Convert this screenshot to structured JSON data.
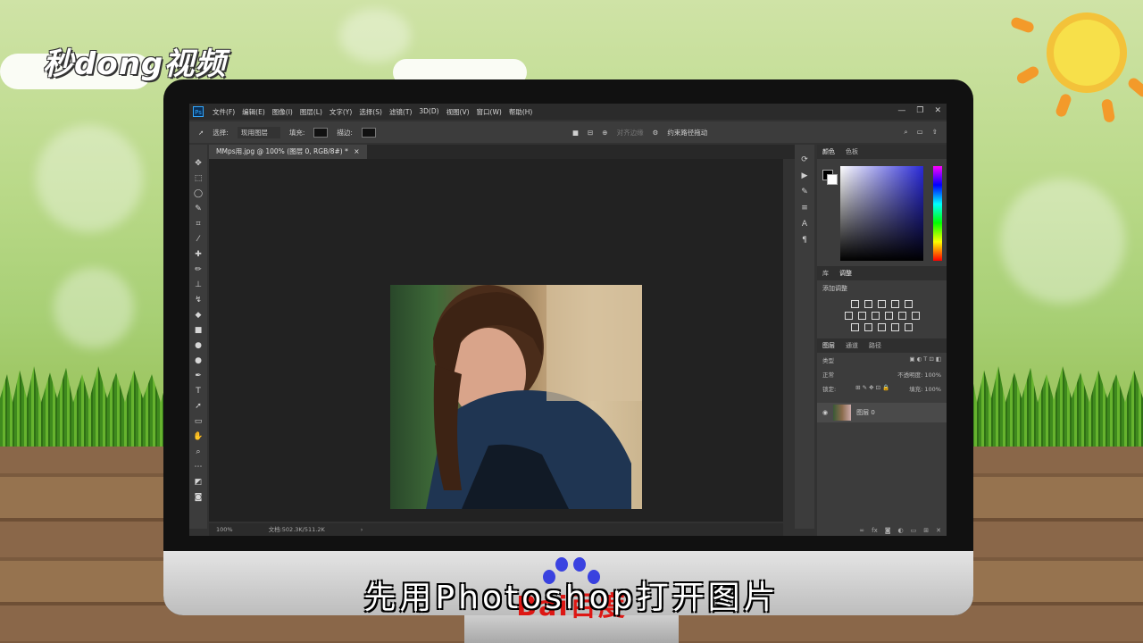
{
  "watermark": {
    "logo_text": "秒dong视频"
  },
  "window": {
    "menu": [
      "文件(F)",
      "编辑(E)",
      "图像(I)",
      "图层(L)",
      "文字(Y)",
      "选择(S)",
      "滤镜(T)",
      "3D(D)",
      "视图(V)",
      "窗口(W)",
      "帮助(H)"
    ],
    "controls": [
      "—",
      "❐",
      "✕"
    ]
  },
  "options_bar": {
    "select_label": "选择:",
    "select_value": "现用图层",
    "fill_label": "填充:",
    "stroke_label": "描边:",
    "align_edges": "对齐边缘",
    "constrain_path": "约束路径拖动"
  },
  "document_tab": {
    "label": "MMps用.jpg @ 100% (图层 0, RGB/8#) *",
    "close": "×"
  },
  "status_bar": {
    "zoom": "100%",
    "doc_info": "文档:502.3K/511.2K",
    "arrow": "›"
  },
  "panels": {
    "color_tabs": [
      "颜色",
      "色板"
    ],
    "adjust_tabs": [
      "库",
      "调整"
    ],
    "adjust_title": "添加调整",
    "layer_tabs": [
      "图层",
      "通道",
      "路径"
    ],
    "filter_type": "类型",
    "blend_mode": "正常",
    "opacity_label": "不透明度: 100%",
    "lock_label": "锁定:",
    "fill_label": "填充: 100%",
    "layer_name": "图层 0"
  },
  "subtitle": "先用Photoshop打开图片",
  "baidu_text": "Bai百度"
}
